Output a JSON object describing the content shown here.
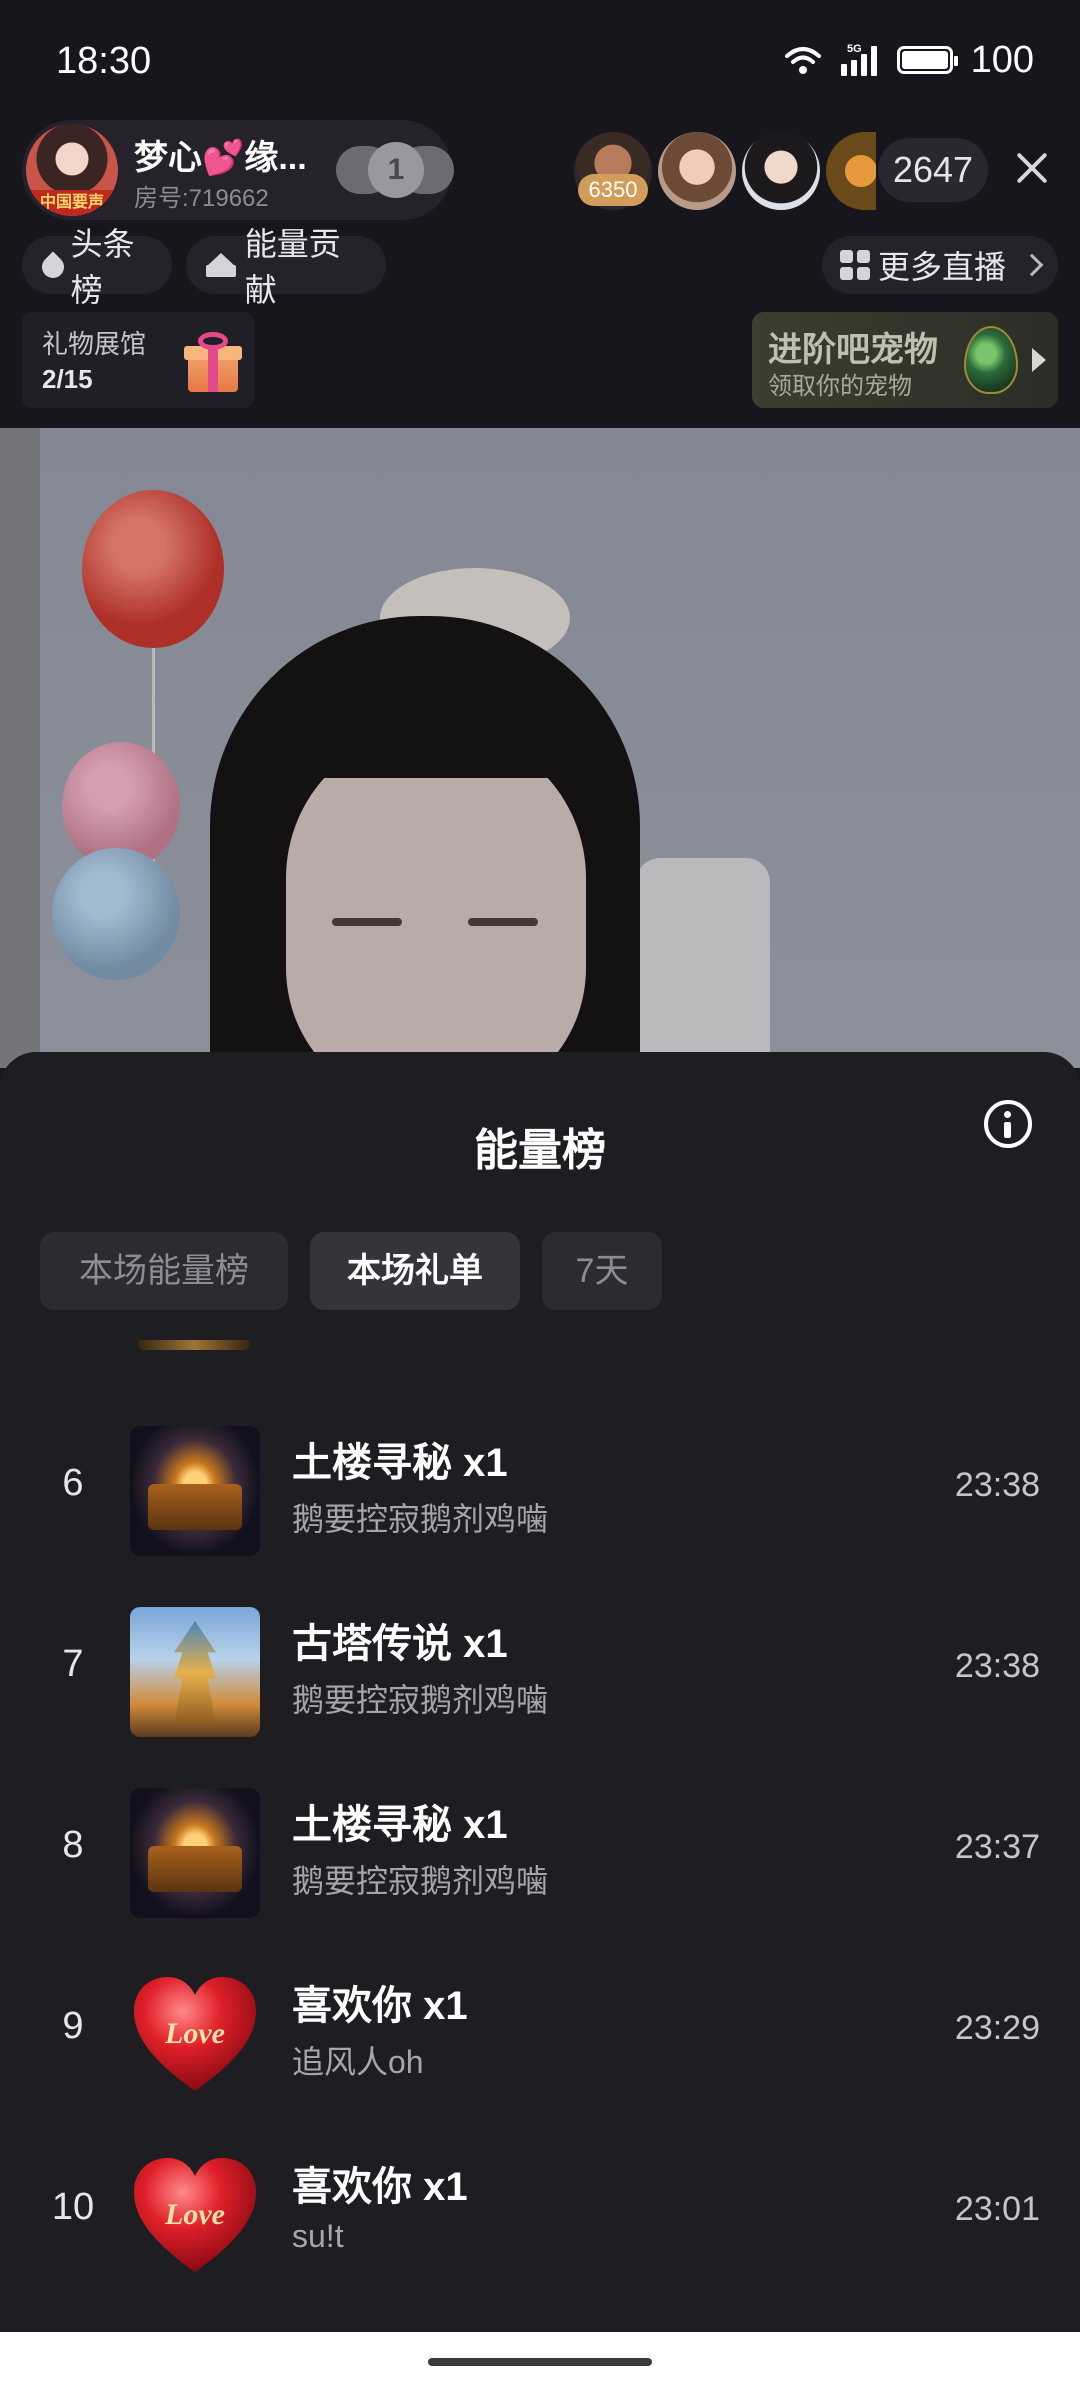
{
  "status_bar": {
    "time": "18:30",
    "network": "5G",
    "battery": "100",
    "icons": [
      "wifi-icon",
      "signal-5g-icon",
      "battery-icon"
    ]
  },
  "host": {
    "name": "梦心💕缘...",
    "room_id": "房号:719662",
    "avatar_tag": "中国要声",
    "fan_level": "1"
  },
  "viewers": {
    "top_viewer_score": "6350",
    "online_count": "2647"
  },
  "nav": {
    "headline_rank": "头条榜",
    "energy_contrib": "能量贡献",
    "more_live": "更多直播"
  },
  "gift_hall": {
    "label": "礼物展馆",
    "count": "2/15"
  },
  "pet_banner": {
    "title": "进阶吧宠物",
    "subtitle": "领取你的宠物"
  },
  "sheet": {
    "title": "能量榜",
    "tabs": [
      {
        "label": "本场能量榜",
        "active": false
      },
      {
        "label": "本场礼单",
        "active": true
      },
      {
        "label": "7天",
        "active": false
      }
    ],
    "items": [
      {
        "rank": "6",
        "gift": "土楼寻秘  x1",
        "user": "鹅要控寂鹅剂鸡噛",
        "time": "23:38",
        "thumb": "tulou"
      },
      {
        "rank": "7",
        "gift": "古塔传说  x1",
        "user": "鹅要控寂鹅剂鸡噛",
        "time": "23:38",
        "thumb": "pagoda"
      },
      {
        "rank": "8",
        "gift": "土楼寻秘  x1",
        "user": "鹅要控寂鹅剂鸡噛",
        "time": "23:37",
        "thumb": "tulou"
      },
      {
        "rank": "9",
        "gift": "喜欢你  x1",
        "user": "追风人oh",
        "time": "23:29",
        "thumb": "heart"
      },
      {
        "rank": "10",
        "gift": "喜欢你  x1",
        "user": "su!t",
        "time": "23:01",
        "thumb": "heart"
      }
    ],
    "heart_text": "Love"
  },
  "colors": {
    "background": "#18161d",
    "sheet": "#1e1e22",
    "active_tab": "#34343b",
    "heart": "#e0202a"
  }
}
